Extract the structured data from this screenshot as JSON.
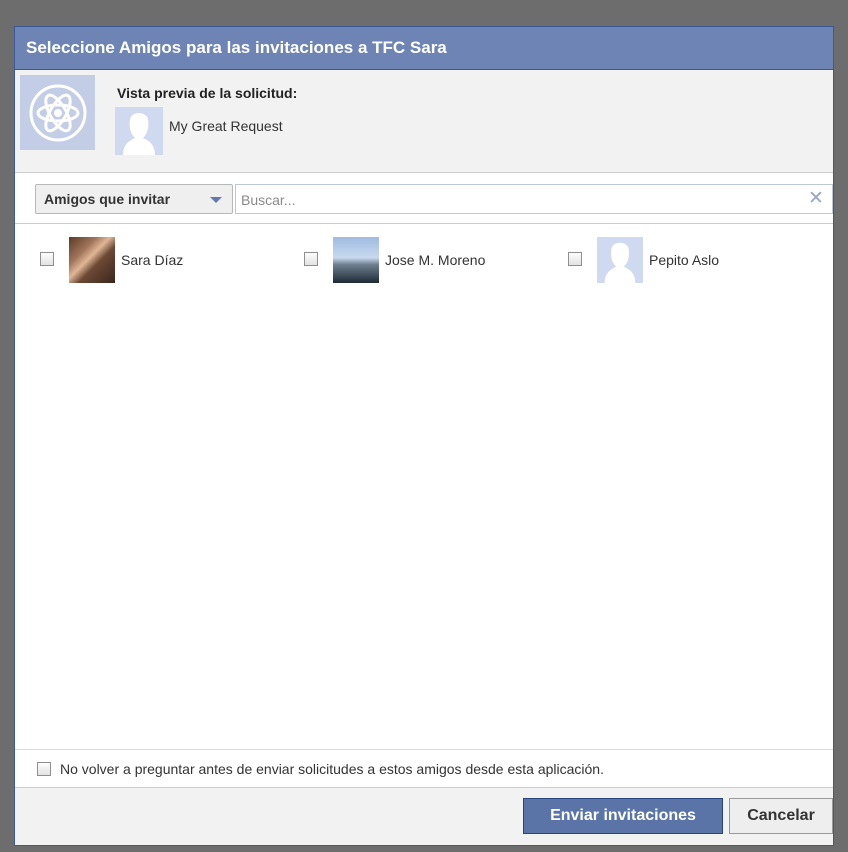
{
  "dialog": {
    "title": "Seleccione Amigos para las invitaciones a TFC Sara"
  },
  "preview": {
    "title": "Vista previa de la solicitud:",
    "request_text": "My Great Request"
  },
  "filter": {
    "dropdown_label": "Amigos que invitar",
    "search_placeholder": "Buscar..."
  },
  "friends": [
    {
      "name": "Sara Díaz",
      "checked": false
    },
    {
      "name": "Jose M. Moreno",
      "checked": false
    },
    {
      "name": "Pepito Aslo",
      "checked": false
    }
  ],
  "footer": {
    "option_label": "No volver a preguntar antes de enviar solicitudes a estos amigos desde esta aplicación.",
    "send_label": "Enviar invitaciones",
    "cancel_label": "Cancelar"
  },
  "colors": {
    "header_bg": "#6d84b4",
    "primary_button": "#5b74a8",
    "border": "#3b5998"
  }
}
